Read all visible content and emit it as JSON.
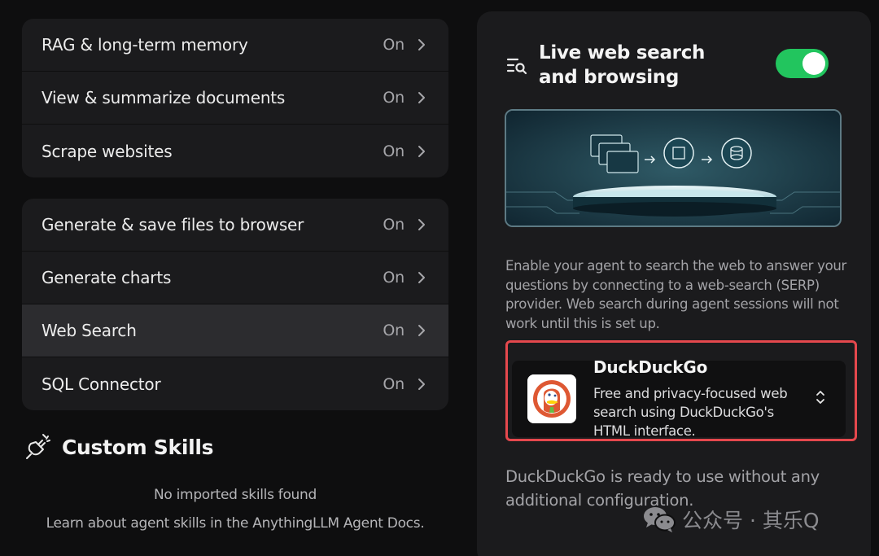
{
  "skills_group_1": [
    {
      "label": "RAG & long-term memory",
      "status": "On"
    },
    {
      "label": "View & summarize documents",
      "status": "On"
    },
    {
      "label": "Scrape websites",
      "status": "On"
    }
  ],
  "skills_group_2": [
    {
      "label": "Generate & save files to browser",
      "status": "On"
    },
    {
      "label": "Generate charts",
      "status": "On"
    },
    {
      "label": "Web Search",
      "status": "On",
      "selected": true
    },
    {
      "label": "SQL Connector",
      "status": "On"
    }
  ],
  "custom_skills": {
    "title": "Custom Skills",
    "empty_message": "No imported skills found",
    "learn_more": "Learn about agent skills in the AnythingLLM Agent Docs."
  },
  "panel": {
    "title": "Live web search and browsing",
    "toggle_on": true,
    "description": "Enable your agent to search the web to answer your questions by connecting to a web-search (SERP) provider. Web search during agent sessions will not work until this is set up.",
    "provider": {
      "name": "DuckDuckGo",
      "description": "Free and privacy-focused web search using DuckDuckGo's HTML interface."
    },
    "ready_text": "DuckDuckGo is ready to use without any additional configuration."
  },
  "watermark": "公众号 · 其乐Q",
  "colors": {
    "background": "#0e0e0f",
    "card": "#1b1b1d",
    "selected_row": "#2c2c2f",
    "toggle_on": "#22c55e",
    "highlight_border": "#e5484d"
  }
}
